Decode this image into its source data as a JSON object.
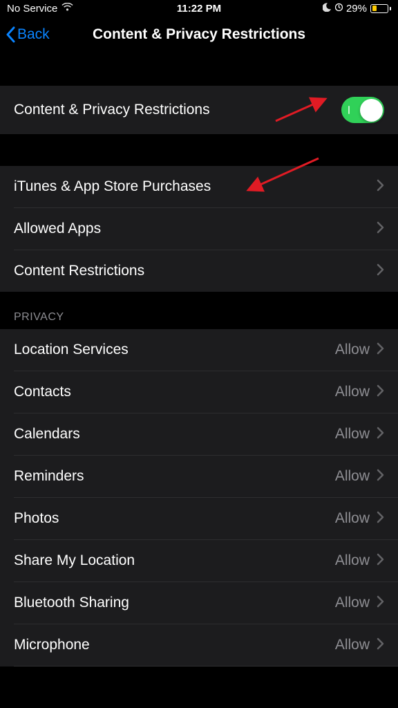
{
  "status": {
    "carrier": "No Service",
    "time": "11:22 PM",
    "battery_percent": "29%"
  },
  "nav": {
    "back_label": "Back",
    "title": "Content & Privacy Restrictions"
  },
  "main_toggle": {
    "label": "Content & Privacy Restrictions",
    "enabled": true
  },
  "section1": {
    "items": [
      {
        "label": "iTunes & App Store Purchases"
      },
      {
        "label": "Allowed Apps"
      },
      {
        "label": "Content Restrictions"
      }
    ]
  },
  "privacy_header": "PRIVACY",
  "privacy": {
    "allow_text": "Allow",
    "items": [
      {
        "label": "Location Services",
        "value": "Allow"
      },
      {
        "label": "Contacts",
        "value": "Allow"
      },
      {
        "label": "Calendars",
        "value": "Allow"
      },
      {
        "label": "Reminders",
        "value": "Allow"
      },
      {
        "label": "Photos",
        "value": "Allow"
      },
      {
        "label": "Share My Location",
        "value": "Allow"
      },
      {
        "label": "Bluetooth Sharing",
        "value": "Allow"
      },
      {
        "label": "Microphone",
        "value": "Allow"
      }
    ]
  }
}
